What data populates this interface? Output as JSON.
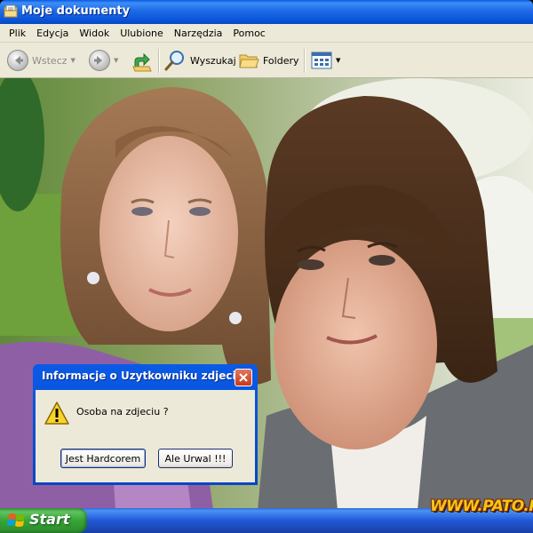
{
  "window": {
    "title": "Moje dokumenty"
  },
  "menu": [
    "Plik",
    "Edycja",
    "Widok",
    "Ulubione",
    "Narzędzia",
    "Pomoc"
  ],
  "toolbar": {
    "back_label": "Wstecz",
    "search_label": "Wyszukaj",
    "folders_label": "Foldery"
  },
  "dialog": {
    "title": "Informacje o Uzytkowniku zdjecia",
    "message": "Osoba na zdjeciu ?",
    "button_yes": "Jest Hardcorem",
    "button_no": "Ale Urwal !!!"
  },
  "taskbar": {
    "start_label": "Start"
  },
  "watermark": "WWW.PATO.PL",
  "colors": {
    "titlebar": "#0a52d8",
    "chrome": "#ece9d8",
    "start_green": "#37a537",
    "watermark_yellow": "#f5c518"
  }
}
